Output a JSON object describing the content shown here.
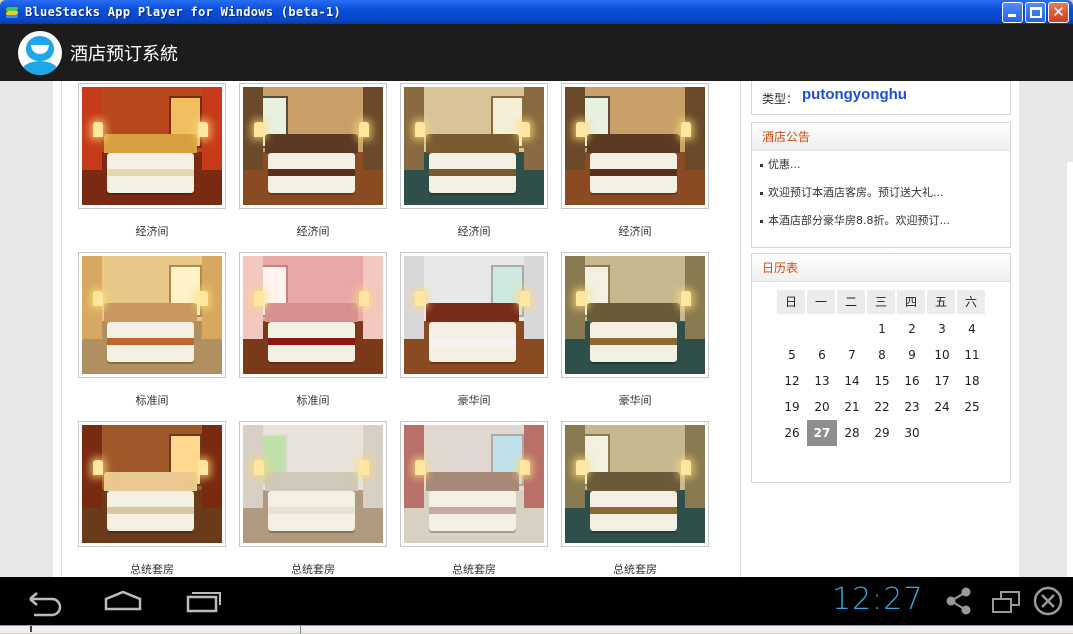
{
  "window": {
    "title": "BlueStacks App Player for Windows (beta-1)",
    "icon": "bluestacks-logo-icon",
    "buttons": [
      "minimize-icon",
      "maximize-icon",
      "close-icon"
    ]
  },
  "app_bar": {
    "title": "酒店预订系統",
    "logo": "user-avatar-icon"
  },
  "rooms": [
    {
      "name": "经济间",
      "palette": {
        "wall": "#b8471c",
        "floor": "#7a2a12",
        "curtain": "#c63b1a",
        "hb": "#d8a040",
        "runner": "#e8d8b0",
        "win": "#f0c060",
        "winframe": "#7a2a12"
      }
    },
    {
      "name": "经济间",
      "palette": {
        "wall": "#c9a068",
        "floor": "#8a4a22",
        "curtain": "#6a4a2a",
        "hb": "#5a3a22",
        "runner": "#5a3018",
        "win": "#e8f0e0",
        "winframe": "#5a4a3a"
      }
    },
    {
      "name": "经济间",
      "palette": {
        "wall": "#d9c49a",
        "floor": "#2f4f4a",
        "curtain": "#8a6a40",
        "hb": "#7a5a30",
        "runner": "#7a5a30",
        "win": "#f4f0d8",
        "winframe": "#8a6a40"
      }
    },
    {
      "name": "经济间",
      "palette": {
        "wall": "#c9a068",
        "floor": "#8a4a22",
        "curtain": "#6a4a2a",
        "hb": "#5a3a22",
        "runner": "#5a3018",
        "win": "#e8f0e0",
        "winframe": "#5a4a3a"
      }
    },
    {
      "name": "标准间",
      "palette": {
        "wall": "#e8c888",
        "floor": "#b09060",
        "curtain": "#d8a860",
        "hb": "#c89860",
        "runner": "#c0662a",
        "win": "#fff2c8",
        "winframe": "#b08850"
      }
    },
    {
      "name": "标准间",
      "palette": {
        "wall": "#e8a8a8",
        "floor": "#7a3a1a",
        "curtain": "#f2c8c0",
        "hb": "#d89090",
        "runner": "#8a1a10",
        "win": "#fff4f0",
        "winframe": "#c88080"
      }
    },
    {
      "name": "豪华间",
      "palette": {
        "wall": "#e8e8ea",
        "floor": "#8a4a22",
        "curtain": "#d8d8da",
        "hb": "#7a2a1a",
        "runner": "#f4f4f4",
        "win": "#cfe8e0",
        "winframe": "#aaaaaa"
      }
    },
    {
      "name": "豪华间",
      "palette": {
        "wall": "#c8b890",
        "floor": "#2f4f4a",
        "curtain": "#8a7a50",
        "hb": "#6a5a38",
        "runner": "#8a6a30",
        "win": "#f2f0e0",
        "winframe": "#8a7a50"
      }
    },
    {
      "name": "总统套房",
      "palette": {
        "wall": "#a0582a",
        "floor": "#6a3a1a",
        "curtain": "#7a2a10",
        "hb": "#e8c890",
        "runner": "#d8c8a0",
        "win": "#ffd890",
        "winframe": "#6a3a1a"
      }
    },
    {
      "name": "总统套房",
      "palette": {
        "wall": "#e8e4dc",
        "floor": "#b09a80",
        "curtain": "#d8d0c4",
        "hb": "#d0c8b8",
        "runner": "#e8e0d0",
        "win": "#bfe0a8",
        "winframe": "#e0dcd4"
      }
    },
    {
      "name": "总统套房",
      "palette": {
        "wall": "#e0d8d0",
        "floor": "#d8d0c0",
        "curtain": "#b87068",
        "hb": "#a88878",
        "runner": "#c8a8a0",
        "win": "#c0e0ea",
        "winframe": "#b0a8a0"
      }
    },
    {
      "name": "总统套房",
      "palette": {
        "wall": "#c8b890",
        "floor": "#2f4f4a",
        "curtain": "#8a7a50",
        "hb": "#6a5a38",
        "runner": "#8a6a30",
        "win": "#f2f0e0",
        "winframe": "#8a7a50"
      }
    }
  ],
  "sidebar": {
    "user": {
      "type_label": "类型：",
      "type_value": "putongyonghu"
    },
    "notice": {
      "title": "酒店公告",
      "items": [
        "优惠...",
        "欢迎预订本酒店客房。预订送大礼...",
        "本酒店部分豪华房8.8折。欢迎预订..."
      ]
    },
    "calendar": {
      "title": "日历表",
      "weekdays": [
        "日",
        "一",
        "二",
        "三",
        "四",
        "五",
        "六"
      ],
      "weeks": [
        [
          "",
          "",
          "",
          "1",
          "2",
          "3",
          "4"
        ],
        [
          "5",
          "6",
          "7",
          "8",
          "9",
          "10",
          "11"
        ],
        [
          "12",
          "13",
          "14",
          "15",
          "16",
          "17",
          "18"
        ],
        [
          "19",
          "20",
          "21",
          "22",
          "23",
          "24",
          "25"
        ],
        [
          "26",
          "27",
          "28",
          "29",
          "30",
          "",
          ""
        ]
      ],
      "today": "27"
    }
  },
  "nav_bar": {
    "clock": "12:27",
    "buttons": [
      "back-icon",
      "home-icon",
      "recent-apps-icon",
      "share-icon",
      "window-icon",
      "close-app-icon"
    ],
    "accent": "#38a6df"
  }
}
